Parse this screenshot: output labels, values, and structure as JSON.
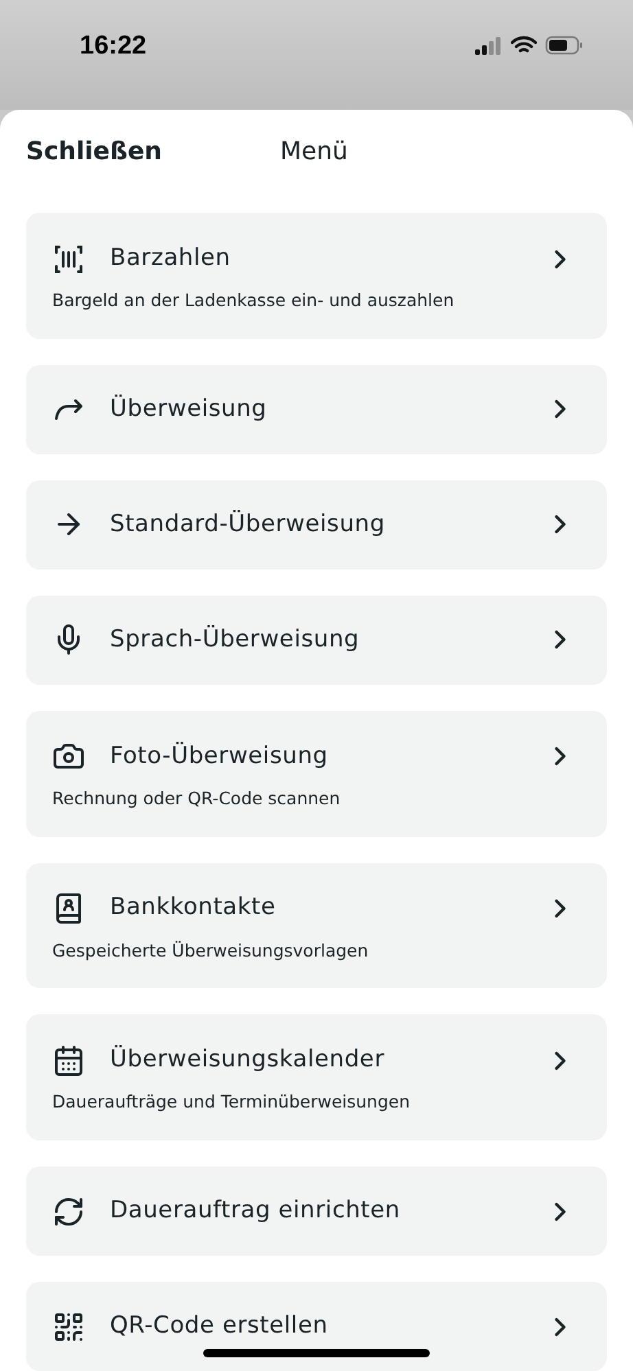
{
  "status_bar": {
    "time": "16:22"
  },
  "sheet": {
    "close_label": "Schließen",
    "title": "Menü"
  },
  "items": [
    {
      "title": "Barzahlen",
      "subtitle": "Bargeld an der Ladenkasse ein- und auszahlen"
    },
    {
      "title": "Überweisung"
    },
    {
      "title": "Standard-Überweisung"
    },
    {
      "title": "Sprach-Überweisung"
    },
    {
      "title": "Foto-Überweisung",
      "subtitle": "Rechnung oder QR-Code scannen"
    },
    {
      "title": "Bankkontakte",
      "subtitle": "Gespeicherte Überweisungsvorlagen"
    },
    {
      "title": "Überweisungskalender",
      "subtitle": "Daueraufträge und Terminüberweisungen"
    },
    {
      "title": "Dauerauftrag einrichten"
    },
    {
      "title": "QR-Code erstellen"
    }
  ]
}
